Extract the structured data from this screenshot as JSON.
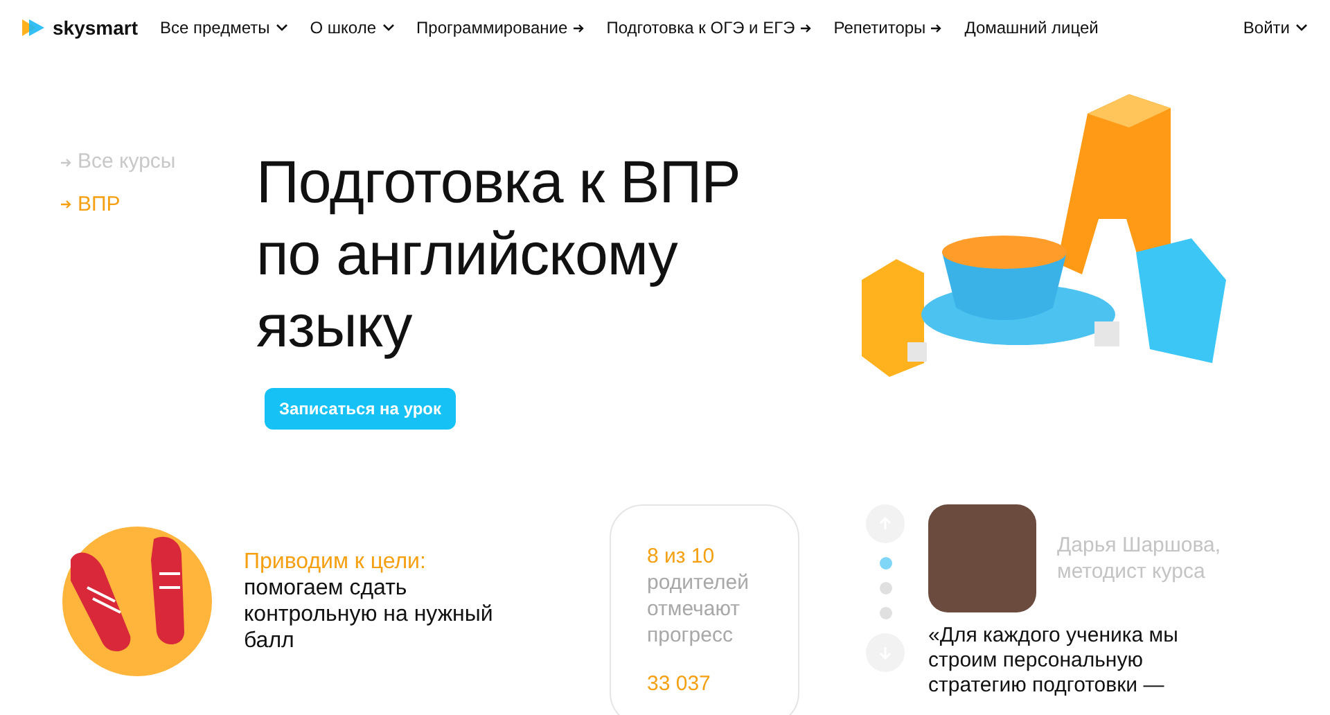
{
  "header": {
    "logo": "skysmart",
    "nav": [
      {
        "label": "Все предметы",
        "kind": "dropdown"
      },
      {
        "label": "О школе",
        "kind": "dropdown"
      },
      {
        "label": "Программирование",
        "kind": "arrow"
      },
      {
        "label": "Подготовка к ОГЭ и ЕГЭ",
        "kind": "arrow"
      },
      {
        "label": "Репетиторы",
        "kind": "arrow"
      },
      {
        "label": "Домашний лицей",
        "kind": "plain"
      }
    ],
    "login": "Войти"
  },
  "breadcrumbs": [
    {
      "label": "Все курсы",
      "selected": false
    },
    {
      "label": "ВПР",
      "selected": true
    }
  ],
  "hero": {
    "title_lines": [
      "Подготовка к ВПР",
      "по английскому",
      "языку"
    ],
    "cta": "Записаться на урок"
  },
  "feature": {
    "title": "Приводим к цели:",
    "text": "помогаем сдать контрольную на нужный балл"
  },
  "stats": [
    {
      "value": "8 из 10",
      "label": "родителей отмечают прогресс"
    },
    {
      "value": "33 037"
    }
  ],
  "quote": {
    "dots": [
      {
        "selected": true
      },
      {
        "selected": false
      },
      {
        "selected": false
      }
    ],
    "author": "Дарья Шаршова,",
    "role": "методист курса",
    "text": "«Для каждого ученика мы строим персональную стратегию подготовки —"
  }
}
